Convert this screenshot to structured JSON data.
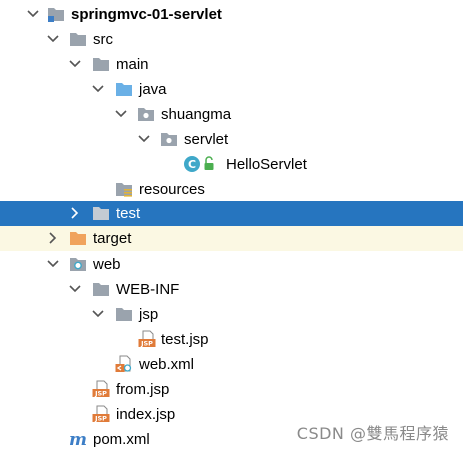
{
  "project_tree": {
    "root": {
      "label": "springmvc-01-servlet",
      "icon": "module-folder-icon",
      "expanded": true
    },
    "src": {
      "label": "src",
      "icon": "folder-icon",
      "expanded": true
    },
    "main": {
      "label": "main",
      "icon": "folder-icon",
      "expanded": true
    },
    "java": {
      "label": "java",
      "icon": "source-root-folder-icon",
      "expanded": true
    },
    "shuangma": {
      "label": "shuangma",
      "icon": "package-icon",
      "expanded": true
    },
    "servlet": {
      "label": "servlet",
      "icon": "package-icon",
      "expanded": true
    },
    "hello_servlet": {
      "label": "HelloServlet",
      "icon": "java-class-icon",
      "badge": "lock-icon"
    },
    "resources": {
      "label": "resources",
      "icon": "resources-folder-icon"
    },
    "test": {
      "label": "test",
      "icon": "folder-icon",
      "expanded": false,
      "selected": true
    },
    "target": {
      "label": "target",
      "icon": "excluded-folder-icon",
      "expanded": false
    },
    "web": {
      "label": "web",
      "icon": "web-folder-icon",
      "expanded": true
    },
    "web_inf": {
      "label": "WEB-INF",
      "icon": "folder-icon",
      "expanded": true
    },
    "jsp": {
      "label": "jsp",
      "icon": "folder-icon",
      "expanded": true
    },
    "test_jsp": {
      "label": "test.jsp",
      "icon": "jsp-file-icon"
    },
    "web_xml": {
      "label": "web.xml",
      "icon": "xml-file-icon"
    },
    "from_jsp": {
      "label": "from.jsp",
      "icon": "jsp-file-icon"
    },
    "index_jsp": {
      "label": "index.jsp",
      "icon": "jsp-file-icon"
    },
    "pom_xml": {
      "label": "pom.xml",
      "icon": "maven-file-icon"
    }
  },
  "watermark": "CSDN @雙馬程序猿",
  "colors": {
    "selection": "#2675bf",
    "excluded_row": "#fbf8e3",
    "folder": "#9aa3ad",
    "source_folder": "#6ab0e6",
    "excluded_folder": "#f0a35c",
    "class_icon": "#3fa8c9",
    "jsp_icon": "#e07b39"
  }
}
